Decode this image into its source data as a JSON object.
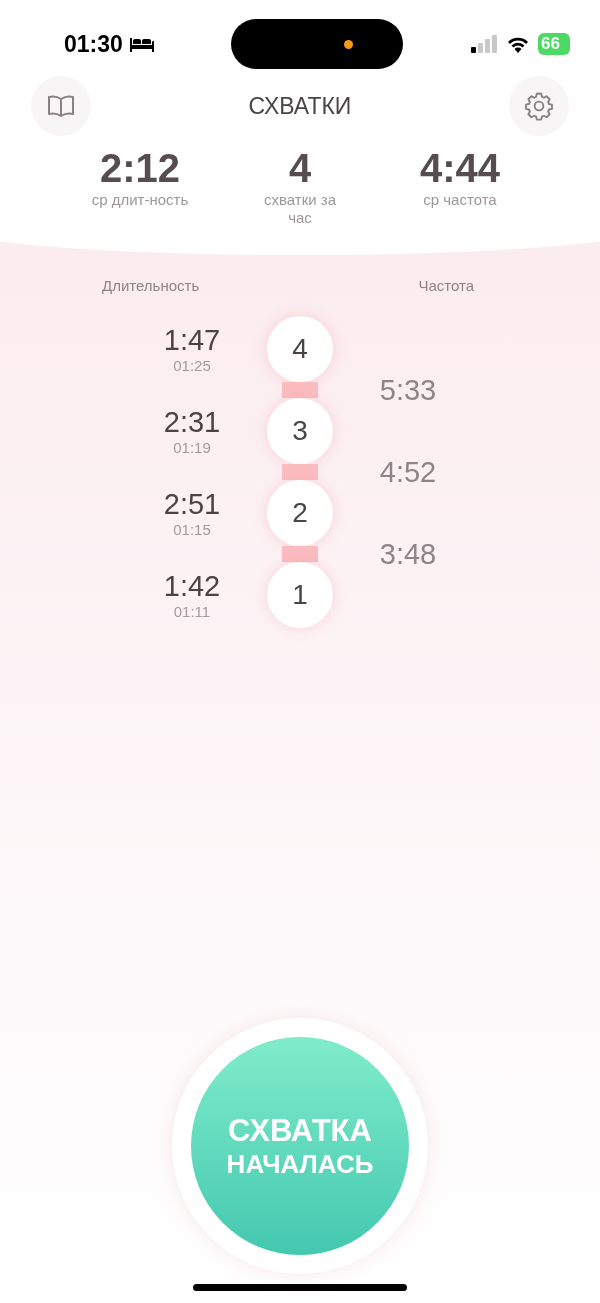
{
  "status_bar": {
    "time": "01:30",
    "battery": "66"
  },
  "header": {
    "title": "СХВАТКИ"
  },
  "stats": [
    {
      "value": "2:12",
      "label": "ср длит-ность"
    },
    {
      "value": "4",
      "label": "схватки за час"
    },
    {
      "value": "4:44",
      "label": "ср частота"
    }
  ],
  "columns": {
    "duration": "Длительность",
    "frequency": "Частота"
  },
  "contractions": [
    {
      "number": "4",
      "duration": "1:47",
      "start": "01:25"
    },
    {
      "number": "3",
      "duration": "2:31",
      "start": "01:19"
    },
    {
      "number": "2",
      "duration": "2:51",
      "start": "01:15"
    },
    {
      "number": "1",
      "duration": "1:42",
      "start": "01:11"
    }
  ],
  "intervals": [
    "5:33",
    "4:52",
    "3:48"
  ],
  "start_button": {
    "line1": "СХВАТКА",
    "line2": "НАЧАЛАСЬ"
  }
}
